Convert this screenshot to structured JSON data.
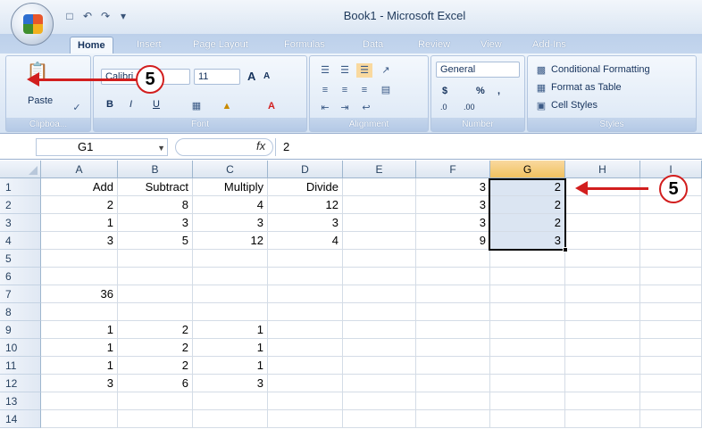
{
  "window": {
    "title": "Book1 - Microsoft Excel"
  },
  "qat": {
    "save_icon": "save-icon",
    "undo_icon": "undo-icon",
    "redo_icon": "redo-icon",
    "customize_icon": "chevron-down-icon"
  },
  "tabs": [
    {
      "label": "Home",
      "active": true
    },
    {
      "label": "Insert",
      "active": false
    },
    {
      "label": "Page Layout",
      "active": false
    },
    {
      "label": "Formulas",
      "active": false
    },
    {
      "label": "Data",
      "active": false
    },
    {
      "label": "Review",
      "active": false
    },
    {
      "label": "View",
      "active": false
    },
    {
      "label": "Add-Ins",
      "active": false
    }
  ],
  "ribbon": {
    "clipboard": {
      "paste_label": "Paste",
      "group_label": "Clipboa..."
    },
    "font": {
      "font_name": "Calibri",
      "font_size": "11",
      "grow": "A",
      "shrink": "A",
      "bold": "B",
      "italic": "I",
      "underline": "U",
      "group_label": "Font"
    },
    "alignment": {
      "group_label": "Alignment"
    },
    "number": {
      "format": "General",
      "currency": "$",
      "percent": "%",
      "comma": ",",
      "inc_dec": ".0",
      "dec_dec": ".00",
      "group_label": "Number"
    },
    "styles": {
      "conditional": "Conditional Formatting",
      "table": "Format as Table",
      "cell_styles": "Cell Styles",
      "group_label": "Styles"
    }
  },
  "formula_bar": {
    "name_box": "G1",
    "fx": "fx",
    "value": "2"
  },
  "columns": [
    "A",
    "B",
    "C",
    "D",
    "E",
    "F",
    "G",
    "H",
    "I"
  ],
  "selected_column": "G",
  "rows": [
    {
      "n": "1",
      "A": "Add",
      "B": "Subtract",
      "C": "Multiply",
      "D": "Divide",
      "F": "3",
      "G": "2"
    },
    {
      "n": "2",
      "A": "2",
      "B": "8",
      "C": "4",
      "D": "12",
      "F": "3",
      "G": "2"
    },
    {
      "n": "3",
      "A": "1",
      "B": "3",
      "C": "3",
      "D": "3",
      "F": "3",
      "G": "2"
    },
    {
      "n": "4",
      "A": "3",
      "B": "5",
      "C": "12",
      "D": "4",
      "F": "9",
      "G": "3"
    },
    {
      "n": "5"
    },
    {
      "n": "6"
    },
    {
      "n": "7",
      "A": "36"
    },
    {
      "n": "8"
    },
    {
      "n": "9",
      "A": "1",
      "B": "2",
      "C": "1"
    },
    {
      "n": "10",
      "A": "1",
      "B": "2",
      "C": "1"
    },
    {
      "n": "11",
      "A": "1",
      "B": "2",
      "C": "1"
    },
    {
      "n": "12",
      "A": "3",
      "B": "6",
      "C": "3"
    },
    {
      "n": "13"
    },
    {
      "n": "14"
    }
  ],
  "callouts": [
    {
      "label": "5"
    },
    {
      "label": "5"
    }
  ],
  "colors": {
    "accent": "#d21e1e",
    "selection": "#dbe5f2",
    "header_selected": "#f1c15f"
  }
}
